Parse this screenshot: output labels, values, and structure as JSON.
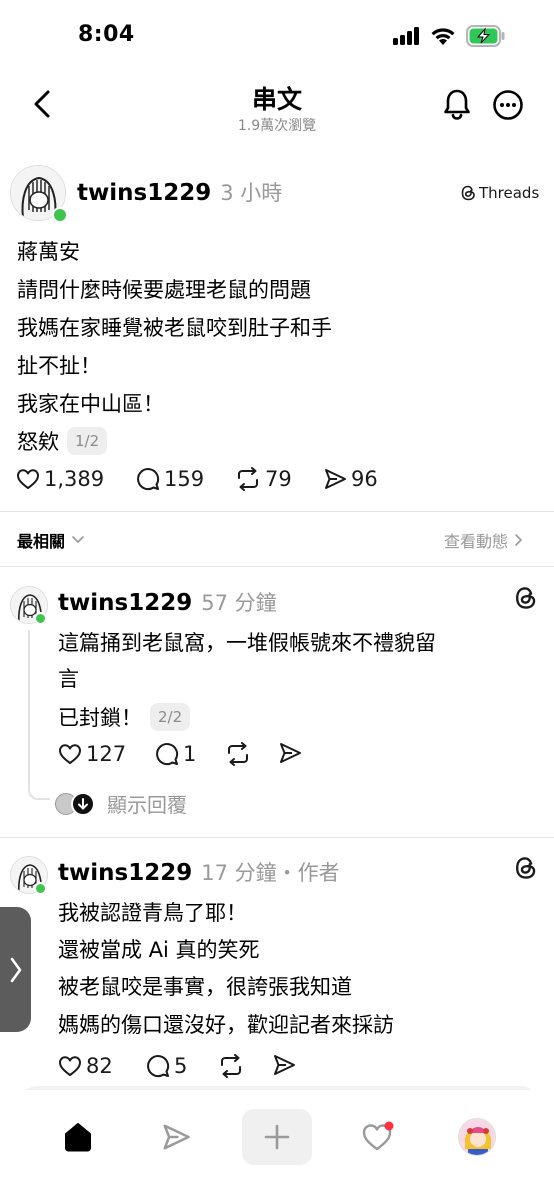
{
  "status_bar": {
    "time": "8:04"
  },
  "header": {
    "title": "串文",
    "subtitle": "1.9萬次瀏覽"
  },
  "post": {
    "username": "twins1229",
    "time": "3 小時",
    "source_badge": "Threads",
    "lines": [
      "蔣萬安",
      "請問什麼時候要處理老鼠的問題",
      "我媽在家睡覺被老鼠咬到肚子和手",
      "扯不扯！",
      "我家在中山區！",
      "怒欸"
    ],
    "page_badge": "1/2",
    "likes": "1,389",
    "comments": "159",
    "reposts": "79",
    "shares": "96"
  },
  "sort_bar": {
    "sort_label": "最相關",
    "activity_label": "查看動態"
  },
  "replies": [
    {
      "username": "twins1229",
      "time": "57 分鐘",
      "tag": "",
      "lines": [
        "這篇捅到老鼠窩，一堆假帳號來不禮貌留",
        "言",
        "已封鎖！"
      ],
      "page_badge": "2/2",
      "likes": "127",
      "comments": "1",
      "show_replies": "顯示回覆"
    },
    {
      "username": "twins1229",
      "time": "17 分鐘",
      "tag": "・作者",
      "lines": [
        "我被認證青鳥了耶！",
        "還被當成 Ai 真的笑死",
        "被老鼠咬是事實，很誇張我知道",
        "媽媽的傷口還沒好，歡迎記者來採訪"
      ],
      "likes": "82",
      "comments": "5"
    }
  ],
  "colors": {
    "online": "#3ec44f",
    "notification": "#ff3040",
    "battery": "#30c759"
  },
  "tab_icons": [
    "home-icon",
    "send-icon",
    "plus-icon",
    "heart-icon",
    "profile-avatar"
  ]
}
